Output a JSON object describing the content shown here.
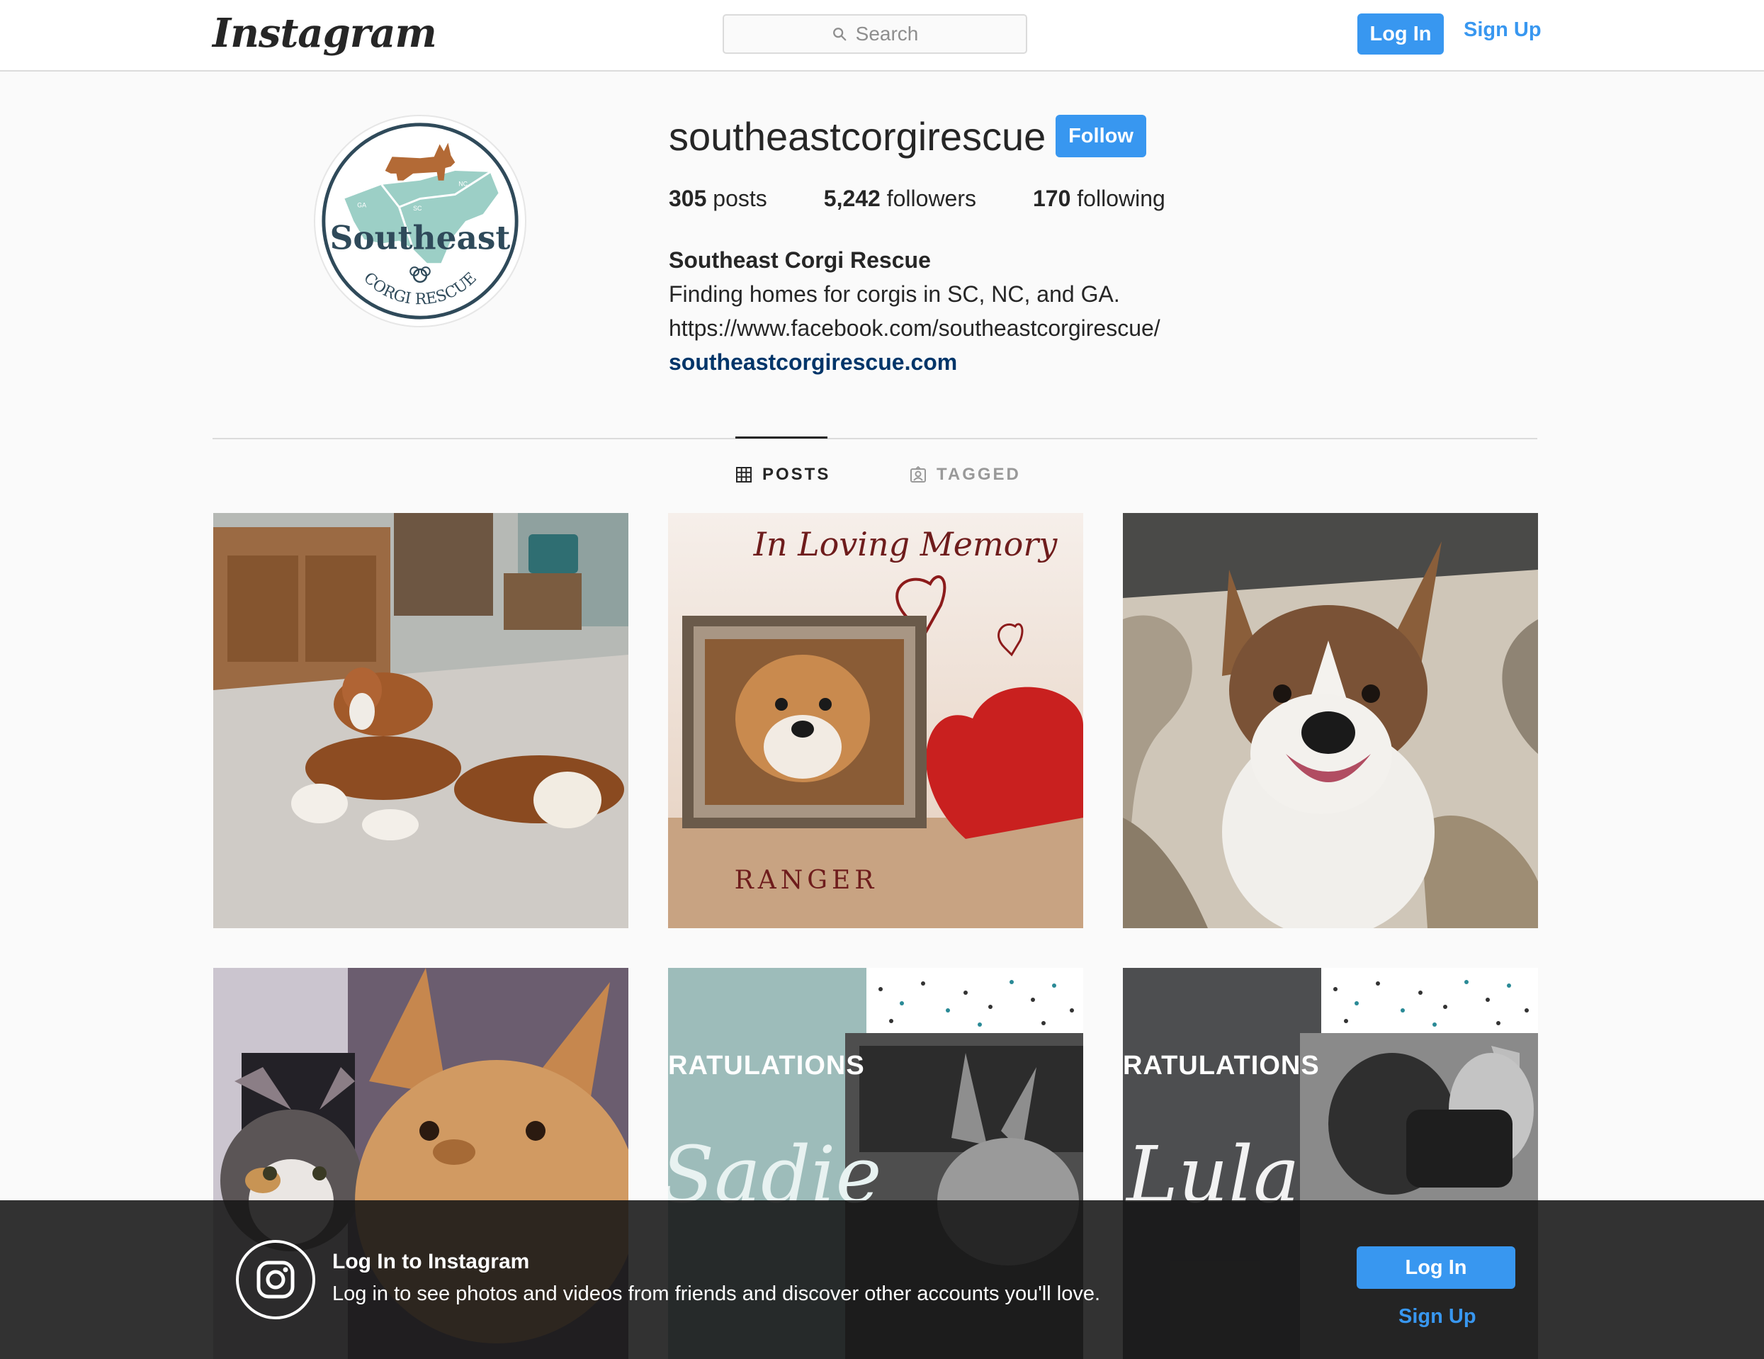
{
  "header": {
    "logo": "Instagram",
    "search_placeholder": "Search",
    "login_label": "Log In",
    "signup_label": "Sign Up"
  },
  "profile": {
    "username": "southeastcorgirescue",
    "follow_label": "Follow",
    "avatar_text": [
      "Southeast",
      "CORGI RESCUE"
    ],
    "avatar_state_labels": [
      "GA",
      "SC",
      "NC"
    ],
    "stats": [
      {
        "value": "305",
        "label": "posts"
      },
      {
        "value": "5,242",
        "label": "followers"
      },
      {
        "value": "170",
        "label": "following"
      }
    ],
    "full_name": "Southeast Corgi Rescue",
    "bio_line": "Finding homes for corgis in SC, NC, and GA.",
    "bio_link": "https://www.facebook.com/southeastcorgirescue/",
    "website": "southeastcorgirescue.com"
  },
  "tabs": [
    {
      "label": "POSTS",
      "icon": "grid-icon",
      "active": true
    },
    {
      "label": "TAGGED",
      "icon": "tagged-icon",
      "active": false
    }
  ],
  "posts": [
    {
      "description": "corgi lying with plush corgi toys"
    },
    {
      "overlay_title": "In Loving Memory",
      "overlay_name": "RANGER"
    },
    {
      "description": "smiling tri-color corgi mix on rug"
    },
    {
      "description": "calico cat and corgi close-up"
    },
    {
      "overlay_title": "RATULATIONS",
      "overlay_name": "Sadie"
    },
    {
      "overlay_title": "RATULATIONS",
      "overlay_name": "Lula"
    }
  ],
  "login_banner": {
    "title": "Log In to Instagram",
    "text": "Log in to see photos and videos from friends and discover other accounts you'll love.",
    "login_label": "Log In",
    "signup_label": "Sign Up"
  },
  "colors": {
    "accent": "#3897f0",
    "link": "#003569",
    "background": "#fafafa"
  }
}
